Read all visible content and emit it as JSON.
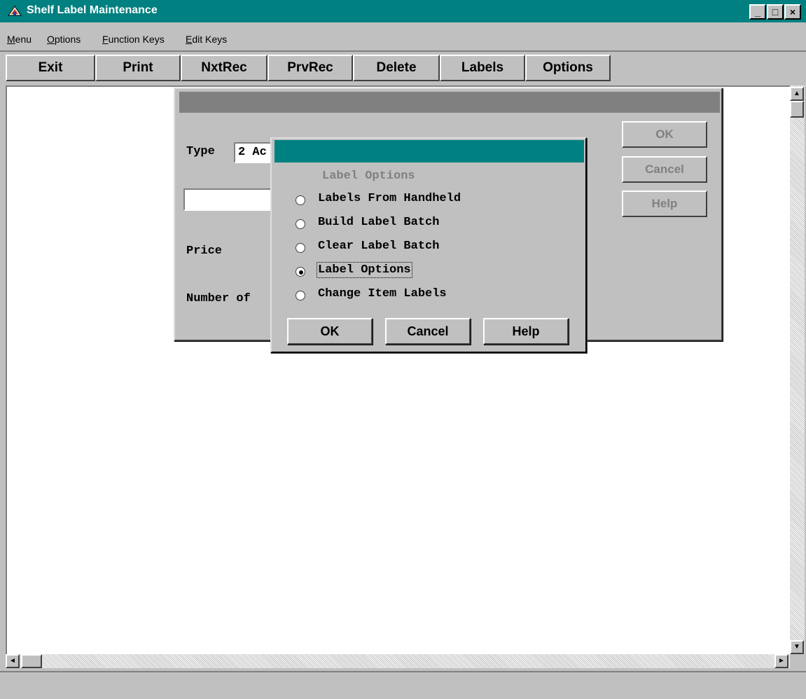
{
  "window": {
    "title": "Shelf Label Maintenance",
    "caption_buttons": {
      "minimize": "_",
      "maximize": "□",
      "close": "×"
    }
  },
  "menubar": {
    "items": [
      {
        "pre": "",
        "u": "M",
        "post": "enu"
      },
      {
        "pre": "",
        "u": "O",
        "post": "ptions"
      },
      {
        "pre": "",
        "u": "F",
        "post": "unction Keys"
      },
      {
        "pre": "",
        "u": "E",
        "post": "dit Keys"
      }
    ]
  },
  "toolbar": {
    "buttons": [
      "Exit",
      "Print",
      "NxtRec",
      "PrvRec",
      "Delete",
      "Labels",
      "Options"
    ]
  },
  "back_dialog": {
    "type_label": "Type",
    "type_value": "2 Ac",
    "price_label": "Price",
    "number_label": "Number of",
    "buttons": [
      "OK",
      "Cancel",
      "Help"
    ]
  },
  "front_dialog": {
    "heading": "Label Options",
    "options": [
      {
        "label": "Labels From Handheld",
        "selected": false
      },
      {
        "label": "Build Label Batch",
        "selected": false
      },
      {
        "label": "Clear Label Batch",
        "selected": false
      },
      {
        "label": "Label Options",
        "selected": true
      },
      {
        "label": "Change Item Labels",
        "selected": false
      }
    ],
    "buttons": {
      "ok": "OK",
      "cancel": "Cancel",
      "help": "Help"
    }
  },
  "scrollbar_glyphs": {
    "up": "▲",
    "down": "▼",
    "left": "◄",
    "right": "►"
  },
  "colors": {
    "titlebar": "#008080",
    "face": "#c0c0c0",
    "disabled_text": "#808080"
  }
}
